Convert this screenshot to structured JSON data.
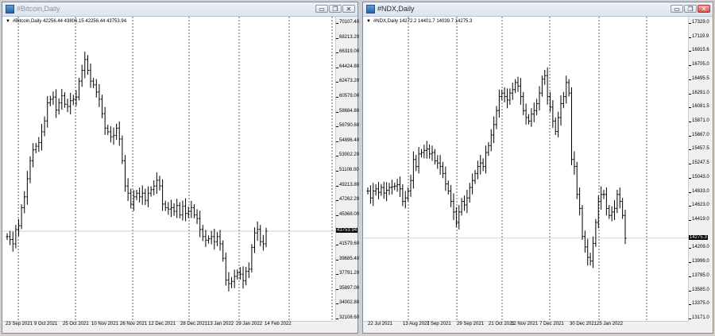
{
  "windows": {
    "left": {
      "title": "#Bitcoin,Daily",
      "symbol_info": "#Bitcoin,Daily  42256.44 43806.15 42256.44 43753.94",
      "current_price": "43753.94",
      "y_ticks": [
        "70107.40",
        "68213.20",
        "66319.00",
        "64424.80",
        "62473.20",
        "60579.00",
        "58684.80",
        "56790.60",
        "54896.40",
        "53002.20",
        "51108.00",
        "49213.80",
        "47262.20",
        "45368.00",
        "43753.94",
        "41579.60",
        "39685.40",
        "37791.20",
        "35897.00",
        "34002.80",
        "32108.60"
      ],
      "x_ticks": [
        "23 Sep 2021",
        "9 Oct 2021",
        "25 Oct 2021",
        "10 Nov 2021",
        "26 Nov 2021",
        "12 Dec 2021",
        "28 Dec 2021",
        "13 Jan 2022",
        "29 Jan 2022",
        "14 Feb 2022"
      ]
    },
    "right": {
      "title": "#NDX,Daily",
      "symbol_info": "#NDX,Daily  14272.2 14401.7 14039.7 14275.3",
      "current_price": "14275.3",
      "y_ticks": [
        "17329.0",
        "17119.9",
        "16915.6",
        "16705.0",
        "16495.5",
        "16291.0",
        "16081.5",
        "15871.0",
        "15667.0",
        "15457.5",
        "15247.5",
        "15043.0",
        "14833.0",
        "14623.0",
        "14419.0",
        "14275.3",
        "14209.0",
        "13999.0",
        "13795.0",
        "13585.0",
        "13375.0",
        "13171.0"
      ],
      "x_ticks": [
        "22 Jul 2021",
        "13 Aug 2021",
        "7 Sep 2021",
        "29 Sep 2021",
        "21 Oct 2021",
        "12 Nov 2021",
        "7 Dec 2021",
        "30 Dec 2021",
        "25 Jan 2022"
      ]
    }
  },
  "buttons": {
    "minimize": "▭",
    "restore": "❐",
    "close": "✕"
  },
  "chart_data": [
    {
      "type": "ohlc",
      "series": [
        {
          "name": "#Bitcoin,Daily",
          "values": [
            43000,
            42600,
            42000,
            44000,
            44500,
            47000,
            48500,
            51000,
            53500,
            55000,
            55500,
            56000,
            57500,
            59000,
            61500,
            62000,
            62300,
            60500,
            61500,
            62500,
            61300,
            61000,
            61800,
            62000,
            62300,
            64500,
            66000,
            67500,
            66000,
            64500,
            64000,
            63000,
            62000,
            60000,
            58000,
            57500,
            56800,
            57000,
            58000,
            56500,
            53500,
            50000,
            49000,
            47500,
            48500,
            49000,
            48500,
            49000,
            48000,
            49000,
            49500,
            50000,
            50800,
            50000,
            47500,
            47000,
            46800,
            47000,
            46500,
            47300,
            46000,
            47200,
            46200,
            46500,
            47000,
            46000,
            45500,
            44000,
            43000,
            42500,
            42700,
            43000,
            42300,
            43000,
            42000,
            40000,
            37000,
            36500,
            36800,
            37500,
            38000,
            37800,
            36900,
            38200,
            38500,
            41500,
            43500,
            44000,
            42300,
            42000,
            43754
          ]
        }
      ],
      "ylim": [
        32108.6,
        71000
      ],
      "ylabel": ""
    },
    {
      "type": "ohlc",
      "series": [
        {
          "name": "#NDX,Daily",
          "values": [
            14950,
            14850,
            14950,
            14980,
            14930,
            15000,
            14920,
            14960,
            15000,
            15010,
            15020,
            15040,
            14980,
            14800,
            14850,
            14950,
            15100,
            15400,
            15300,
            15480,
            15500,
            15530,
            15550,
            15480,
            15500,
            15380,
            15350,
            15300,
            15200,
            15050,
            14950,
            14800,
            14650,
            14500,
            14650,
            14800,
            14750,
            14850,
            15000,
            15100,
            15200,
            15300,
            15350,
            15300,
            15500,
            15600,
            15750,
            15900,
            16100,
            16300,
            16350,
            16300,
            16250,
            16350,
            16400,
            16500,
            16450,
            16300,
            16100,
            16000,
            15950,
            16050,
            16100,
            16200,
            16350,
            16550,
            16600,
            16300,
            16150,
            15950,
            15800,
            16000,
            16200,
            16300,
            16500,
            16350,
            15400,
            15300,
            14900,
            14700,
            14300,
            14150,
            14000,
            13950,
            14200,
            14500,
            14800,
            14900,
            14900,
            14700,
            14600,
            14650,
            14700,
            14900,
            14800,
            14600,
            14275
          ]
        }
      ],
      "ylim": [
        13171.0,
        17329.0
      ],
      "ylabel": ""
    }
  ]
}
